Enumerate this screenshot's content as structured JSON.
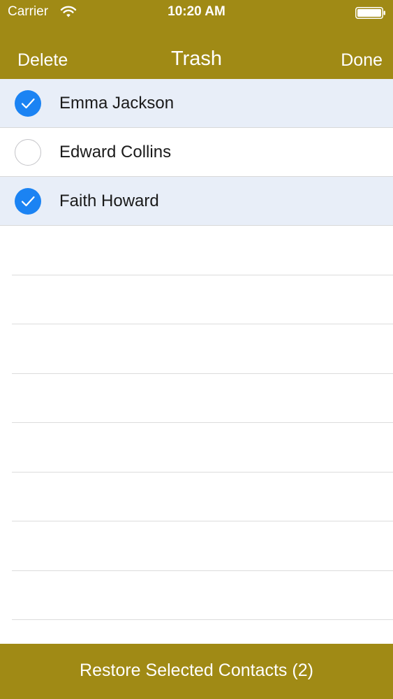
{
  "colors": {
    "accent": "#a08a15",
    "checkbox_selected": "#1b83f3",
    "row_selected_bg": "#e8eef8"
  },
  "status_bar": {
    "carrier": "Carrier",
    "time": "10:20 AM",
    "wifi_icon": "wifi-icon",
    "battery_icon": "battery-icon"
  },
  "nav": {
    "left_label": "Delete",
    "title": "Trash",
    "right_label": "Done"
  },
  "contacts": [
    {
      "name": "Emma Jackson",
      "selected": true
    },
    {
      "name": "Edward Collins",
      "selected": false
    },
    {
      "name": "Faith Howard",
      "selected": true
    }
  ],
  "footer": {
    "restore_label": "Restore Selected Contacts (2)"
  }
}
